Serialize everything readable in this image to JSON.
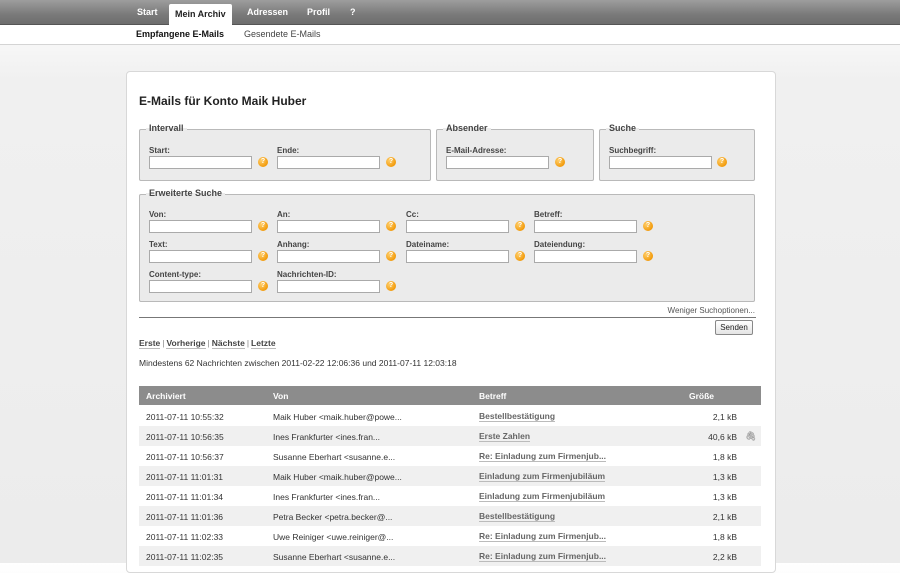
{
  "topnav": {
    "tabs": [
      {
        "label": "Start"
      },
      {
        "label": "Mein Archiv"
      },
      {
        "label": "Adressen"
      },
      {
        "label": "Profil"
      },
      {
        "label": "?"
      }
    ]
  },
  "subnav": {
    "items": [
      {
        "label": "Empfangene E-Mails"
      },
      {
        "label": "Gesendete E-Mails"
      }
    ]
  },
  "page": {
    "title": "E-Mails für Konto Maik Huber"
  },
  "search": {
    "intervall": {
      "legend": "Intervall",
      "start_label": "Start:",
      "end_label": "Ende:"
    },
    "absender": {
      "legend": "Absender",
      "email_label": "E-Mail-Adresse:"
    },
    "suche": {
      "legend": "Suche",
      "term_label": "Suchbegriff:"
    },
    "erweitert": {
      "legend": "Erweiterte Suche",
      "fields": {
        "von": "Von:",
        "an": "An:",
        "cc": "Cc:",
        "betreff": "Betreff:",
        "text": "Text:",
        "anhang": "Anhang:",
        "dateiname": "Dateiname:",
        "dateiendung": "Dateiendung:",
        "content_type": "Content-type:",
        "nachrichten_id": "Nachrichten-ID:"
      }
    },
    "help_glyph": "?",
    "fewer_options": "Weniger Suchoptionen...",
    "send_label": "Senden"
  },
  "pager": {
    "first": "Erste",
    "prev": "Vorherige",
    "next": "Nächste",
    "last": "Letzte",
    "separator": "|"
  },
  "summary": "Mindestens 62 Nachrichten zwischen 2011-02-22 12:06:36 und 2011-07-11 12:03:18",
  "table": {
    "headers": {
      "archived": "Archiviert",
      "from": "Von",
      "subject": "Betreff",
      "size": "Größe"
    },
    "rows": [
      {
        "archived": "2011-07-11 10:55:32",
        "from": "Maik Huber <maik.huber@powe...",
        "subject": "Bestellbestätigung",
        "size": "2,1 kB",
        "attachment": false
      },
      {
        "archived": "2011-07-11 10:56:35",
        "from": "Ines Frankfurter <ines.fran...",
        "subject": "Erste Zahlen",
        "size": "40,6 kB",
        "attachment": true
      },
      {
        "archived": "2011-07-11 10:56:37",
        "from": "Susanne Eberhart <susanne.e...",
        "subject": "Re: Einladung zum Firmenjub...",
        "size": "1,8 kB",
        "attachment": false
      },
      {
        "archived": "2011-07-11 11:01:31",
        "from": "Maik Huber <maik.huber@powe...",
        "subject": "Einladung zum Firmenjubiläum",
        "size": "1,3 kB",
        "attachment": false
      },
      {
        "archived": "2011-07-11 11:01:34",
        "from": "Ines Frankfurter <ines.fran...",
        "subject": "Einladung zum Firmenjubiläum",
        "size": "1,3 kB",
        "attachment": false
      },
      {
        "archived": "2011-07-11 11:01:36",
        "from": "Petra Becker <petra.becker@...",
        "subject": "Bestellbestätigung",
        "size": "2,1 kB",
        "attachment": false
      },
      {
        "archived": "2011-07-11 11:02:33",
        "from": "Uwe Reiniger <uwe.reiniger@...",
        "subject": "Re: Einladung zum Firmenjub...",
        "size": "1,8 kB",
        "attachment": false
      },
      {
        "archived": "2011-07-11 11:02:35",
        "from": "Susanne Eberhart <susanne.e...",
        "subject": "Re: Einladung zum Firmenjub...",
        "size": "2,2 kB",
        "attachment": false
      }
    ],
    "attachment_icon": "paperclip-icon",
    "attachment_glyph": "🖇"
  },
  "colors": {
    "help_icon": "#f29b0c",
    "table_header": "#8c8c8c",
    "nav_bar": "#7a7a7a"
  }
}
